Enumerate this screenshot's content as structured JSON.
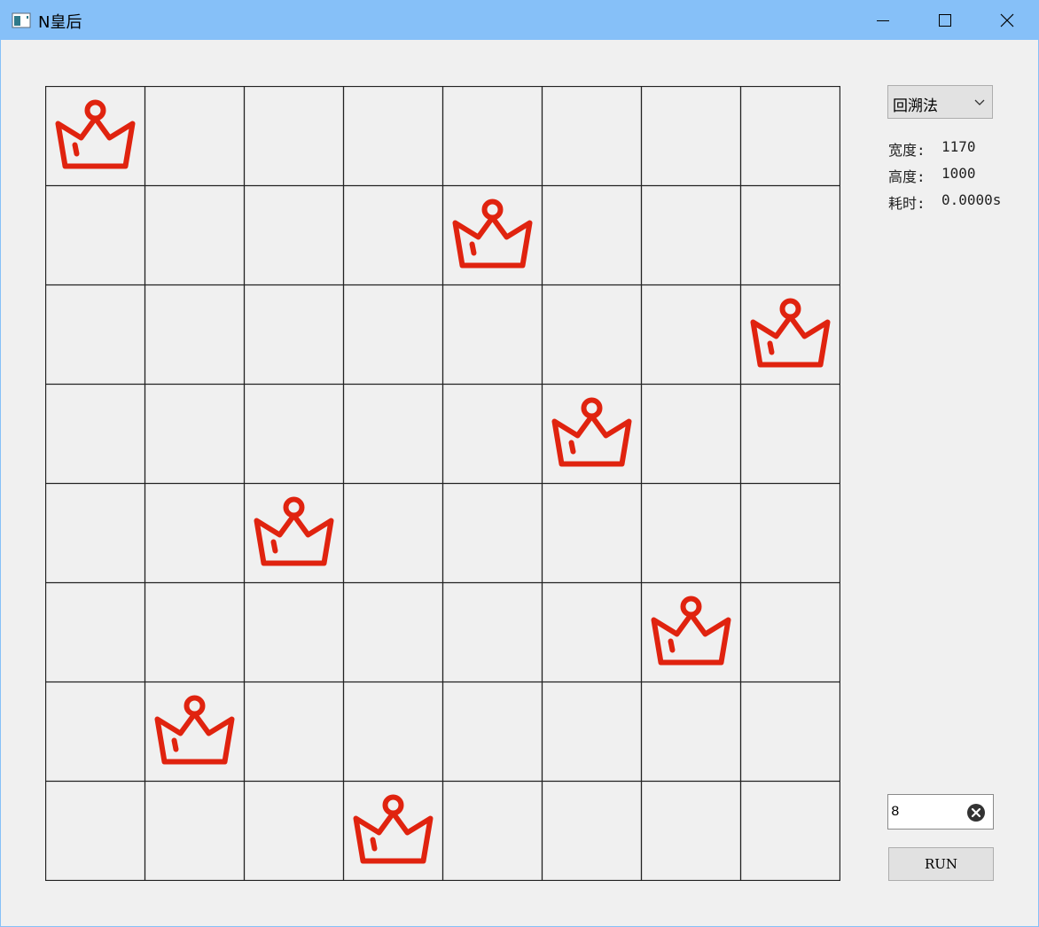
{
  "window": {
    "title": "N皇后",
    "icon": "app-window-icon",
    "controls": [
      "minimize-icon",
      "maximize-icon",
      "close-icon"
    ]
  },
  "board": {
    "size": 8,
    "queen_columns_by_row": [
      0,
      4,
      7,
      5,
      2,
      6,
      1,
      3
    ],
    "queen_icon": "crown-icon",
    "queen_color": "#e0230f",
    "grid_color": "#222222"
  },
  "controls": {
    "algorithm_select": {
      "selected": "回溯法"
    },
    "info": {
      "width_label": "宽度:",
      "width_value": "1170",
      "height_label": "高度:",
      "height_value": "1000",
      "time_label": "耗时:",
      "time_value": "0.0000s"
    },
    "n_input": {
      "value": "8"
    },
    "run_label": "RUN"
  },
  "colors": {
    "titlebar": "#86c0f8",
    "background": "#f0f0f0"
  }
}
